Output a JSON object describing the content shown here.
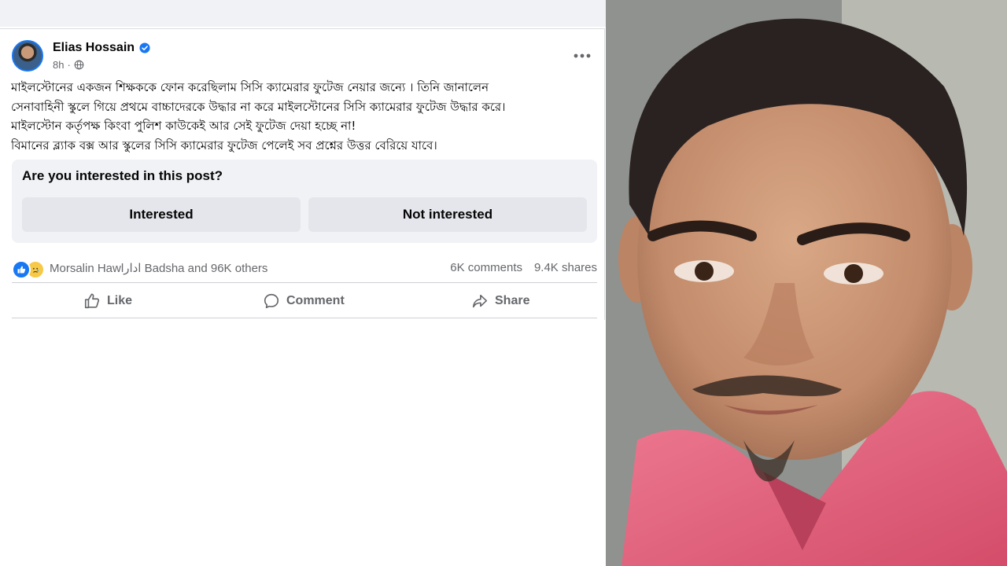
{
  "post": {
    "author": "Elias Hossain",
    "time": "8h",
    "text_lines": [
      "মাইলস্টোনের একজন শিক্ষককে ফোন করেছিলাম সিসি ক্যামেরার ফুটেজ নেয়ার জন্যে । তিনি জানালেন",
      "সেনাবাহিনী স্কুলে গিয়ে প্রথমে বাচ্চাদেরকে উদ্ধার না করে মাইলস্টোনের সিসি ক্যামেরার ফুটেজ উদ্ধার করে।",
      "মাইলস্টোন কর্তৃপক্ষ কিংবা পুলিশ কাউকেই আর সেই ফুটেজ দেয়া হচ্ছে না!",
      "বিমানের ব্ল্যাক বক্স আর স্কুলের সিসি ক্যামেরার ফুটেজ পেলেই সব প্রশ্নের উত্তর বেরিয়ে যাবে।"
    ]
  },
  "interest": {
    "question": "Are you interested in this post?",
    "interested_label": "Interested",
    "not_interested_label": "Not interested"
  },
  "stats": {
    "reactions_text": "Morsalin Hawlادار Badsha and 96K others",
    "comments": "6K comments",
    "shares": "9.4K shares"
  },
  "actions": {
    "like": "Like",
    "comment": "Comment",
    "share": "Share"
  },
  "icons": {
    "verified": "verified-badge-icon",
    "audience": "globe-icon",
    "more": "more-options-icon",
    "like": "thumbs-up-icon",
    "comment": "speech-bubble-icon",
    "share": "share-arrow-icon"
  },
  "colors": {
    "facebook_blue": "#1877f2",
    "secondary_text": "#65676b",
    "button_grey": "#e4e6eb",
    "shirt_pink": "#e2607a"
  }
}
